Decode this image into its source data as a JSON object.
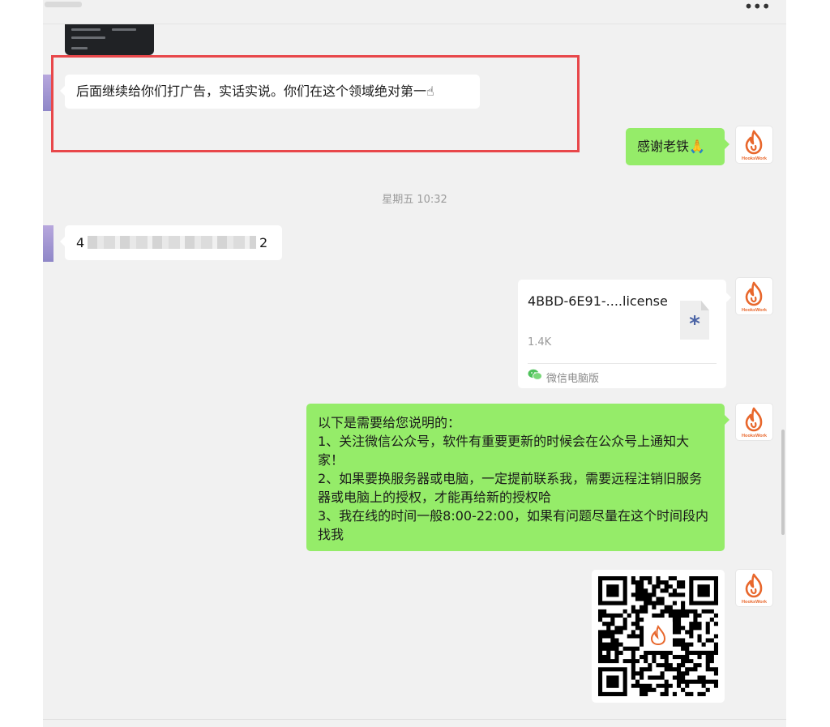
{
  "header": {
    "more_icon": "more-horizontal-icon",
    "more_label": "•••"
  },
  "messages": {
    "ad_text": "后面继续给你们打广告，实话实说。你们在这个领域绝对第一☝",
    "thanks_text": "感谢老铁🙏",
    "timestamp": "星期五 10:32",
    "code_start": "4",
    "code_end": "2",
    "file": {
      "name": "4BBD-6E91-....license",
      "size": "1.4K",
      "source": "微信电脑版"
    },
    "notice_lines": [
      "以下是需要给您说明的：",
      "1、关注微信公众号，软件有重要更新的时候会在公众号上通知大家！",
      "2、如果要换服务器或电脑，一定提前联系我，需要远程注销旧服务器或电脑上的授权，才能再给新的授权哈",
      "3、我在线的时间一般8:00-22:00，如果有问题尽量在这个时间段内找我"
    ]
  },
  "avatar": {
    "brand": "HooksWork",
    "icon": "flame-logo-icon",
    "color": "#e8672c"
  },
  "colors": {
    "highlight": "#e8474a",
    "green_bubble": "#95ec69",
    "chat_bg": "#f1f1f1"
  }
}
